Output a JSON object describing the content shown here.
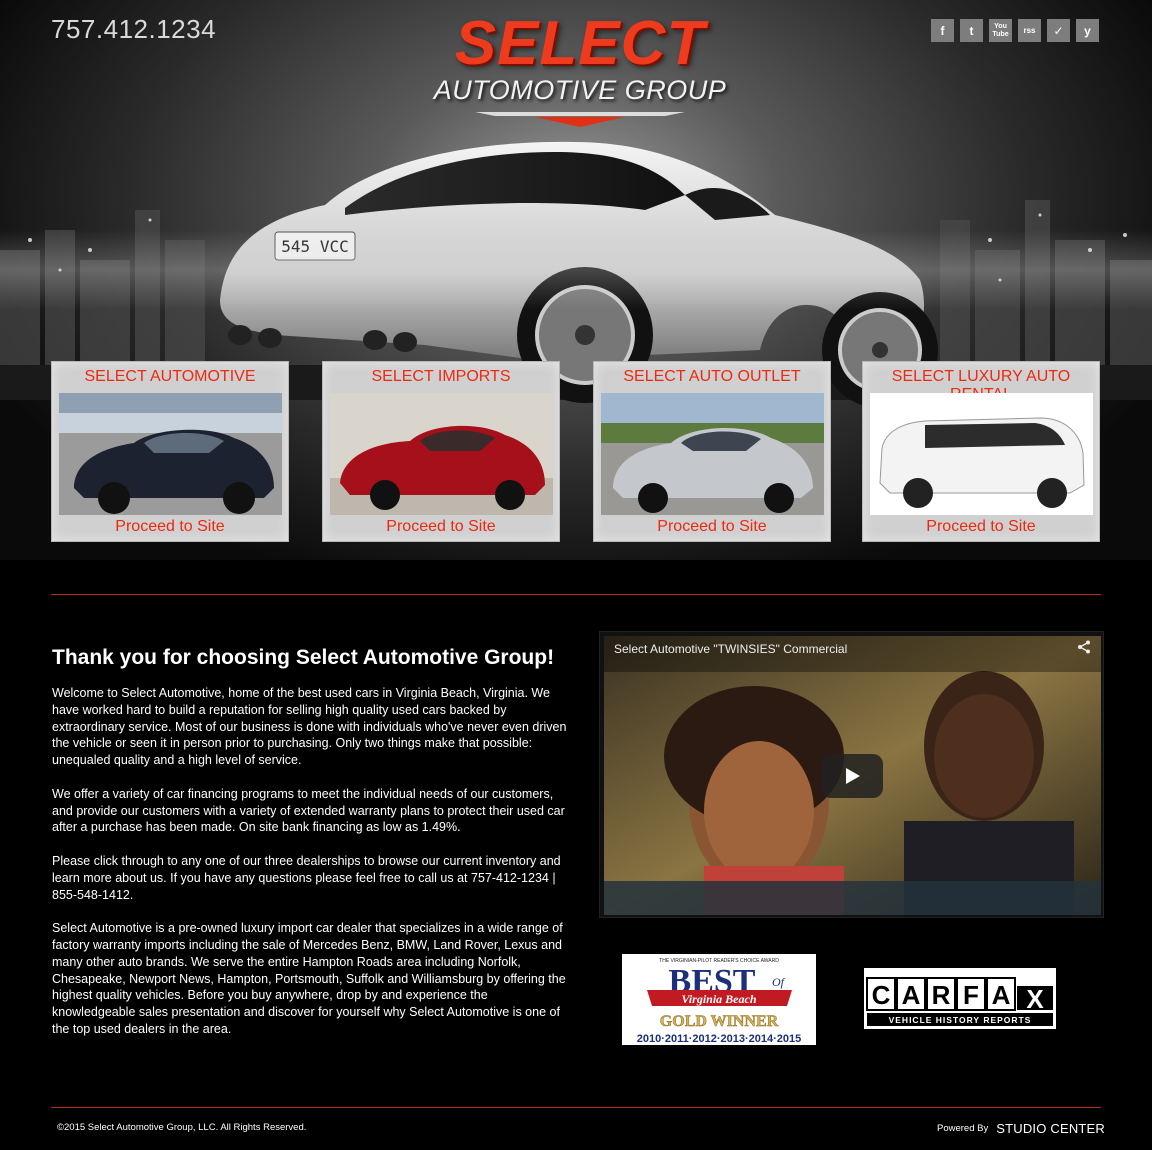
{
  "header": {
    "phone": "757.412.1234",
    "logo_select": "SELECT",
    "logo_group": "AUTOMOTIVE GROUP",
    "plate": "545 VCC",
    "social": [
      {
        "icon": "facebook-icon",
        "glyph": "f"
      },
      {
        "icon": "twitter-icon",
        "glyph": "t"
      },
      {
        "icon": "youtube-icon",
        "glyph": "You Tube"
      },
      {
        "icon": "rss-icon",
        "glyph": "rss"
      },
      {
        "icon": "check-icon",
        "glyph": "✓"
      },
      {
        "icon": "yelp-icon",
        "glyph": "y"
      }
    ]
  },
  "dealers": [
    {
      "name": "SELECT AUTOMOTIVE",
      "link": "Proceed to Site",
      "car_color": "#1c2230"
    },
    {
      "name": "SELECT IMPORTS",
      "link": "Proceed to Site",
      "car_color": "#a5101a"
    },
    {
      "name": "SELECT AUTO OUTLET",
      "link": "Proceed to Site",
      "car_color": "#c4c7cb"
    },
    {
      "name": "SELECT LUXURY AUTO RENTAL",
      "link": "Proceed to Site",
      "car_color": "#f3f3f3"
    }
  ],
  "main": {
    "title": "Thank you for choosing Select Automotive Group!",
    "paragraphs": [
      "Welcome to Select Automotive, home of the best used cars in Virginia Beach, Virginia. We have worked hard to build a reputation for selling high quality used cars backed by extraordinary service. Most of our business is done with individuals who've never even driven the vehicle or seen it in person prior to purchasing. Only two things make that possible: unequaled quality and a high level of service.",
      "We offer a variety of car financing programs to meet the individual needs of our customers, and provide our customers with a variety of extended warranty plans to protect their used car after a purchase has been made. On site bank financing as low as 1.49%.",
      "Please click through to any one of our three dealerships to browse our current inventory and learn more about us. If you have any questions please feel free to call us at 757-412-1234 | 855-548-1412.",
      "Select Automotive is a pre-owned luxury import car dealer that specializes in a wide range of factory warranty imports including the sale of Mercedes Benz, BMW, Land Rover, Lexus and many other auto brands. We serve the entire Hampton Roads area including Norfolk, Chesapeake, Newport News, Hampton, Portsmouth, Suffolk and Williamsburg by offering the highest quality vehicles. Before you buy anywhere, drop by and experience the knowledgeable sales presentation and discover for yourself why Select Automotive is one of the top used dealers in the area."
    ]
  },
  "video": {
    "title": "Select Automotive \"TWINSIES\" Commercial"
  },
  "badges": {
    "best_top": "THE VIRGINIAN-PILOT READER'S CHOICE AWARD",
    "best_word": "BEST",
    "best_of": "Of",
    "best_place": "Virginia Beach",
    "best_winner": "GOLD WINNER",
    "best_years": "2010·2011·2012·2013·2014·2015",
    "carfax_letters": [
      "C",
      "A",
      "R",
      "F",
      "A",
      "X"
    ],
    "carfax_sub": "VEHICLE HISTORY REPORTS"
  },
  "footer": {
    "copyright": "©2015 Select Automotive Group, LLC. All Rights Reserved.",
    "powered_by": "Powered By",
    "brand": "STUDIO CENTER"
  }
}
